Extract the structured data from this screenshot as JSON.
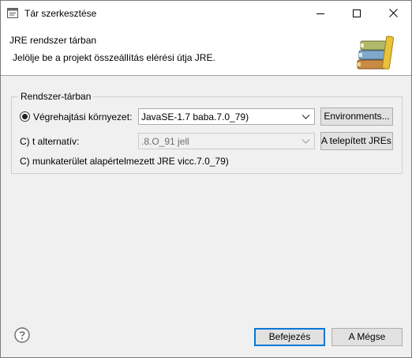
{
  "window": {
    "title": "Tár szerkesztése",
    "app_icon": "eclipse-window-icon"
  },
  "banner": {
    "title": "JRE rendszer tárban",
    "message": "Jelölje be a projekt összeállítás elérési útja JRE.",
    "icon": "library-books-icon"
  },
  "group": {
    "label": "Rendszer-tárban",
    "execution_env": {
      "label": "Végrehajtási környezet:",
      "selected": true,
      "value": "JavaSE-1.7 baba.7.0_79)",
      "button": "Environments..."
    },
    "alternate": {
      "label": "C) t alternatív:",
      "selected": false,
      "value": ".8.O_91 jell",
      "button": "A telepített JREs..."
    },
    "workspace_default": {
      "label": "C) munkaterület alapértelmezett JRE vicc.7.0_79)",
      "selected": false
    }
  },
  "footer": {
    "help_icon": "help-icon",
    "finish_label": "Befejezés",
    "cancel_label": "A Mégse"
  }
}
